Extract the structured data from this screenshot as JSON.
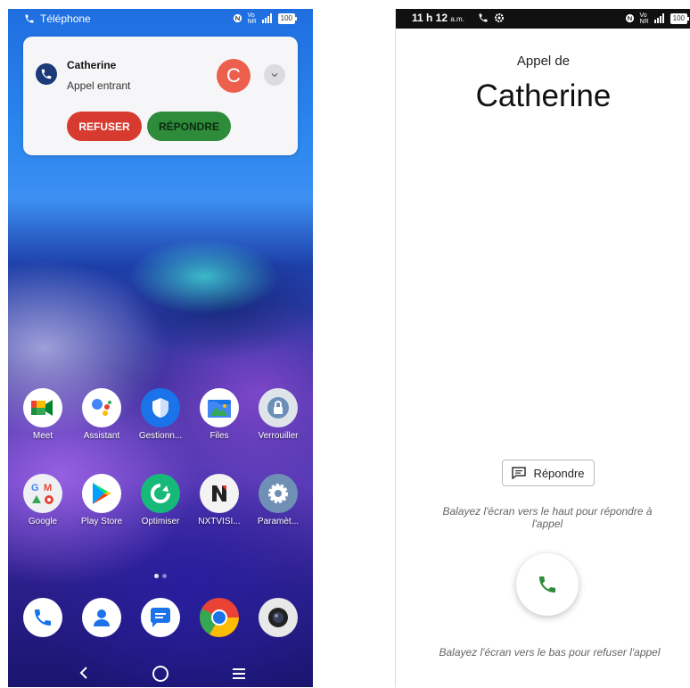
{
  "left_phone": {
    "status_bar": {
      "app_name": "Téléphone",
      "battery": "100"
    },
    "notification": {
      "caller": "Catherine",
      "subtitle": "Appel entrant",
      "avatar_letter": "C",
      "refuse_label": "REFUSER",
      "answer_label": "RÉPONDRE"
    },
    "apps_row1": [
      {
        "label": "Meet"
      },
      {
        "label": "Assistant"
      },
      {
        "label": "Gestionn..."
      },
      {
        "label": "Files"
      },
      {
        "label": "Verrouiller"
      }
    ],
    "apps_row2": [
      {
        "label": "Google"
      },
      {
        "label": "Play Store"
      },
      {
        "label": "Optimiser"
      },
      {
        "label": "NXTVISI..."
      },
      {
        "label": "Paramèt..."
      }
    ]
  },
  "right_phone": {
    "status_bar": {
      "time": "11 h 12",
      "ampm": "a.m.",
      "battery": "100"
    },
    "call_from": "Appel de",
    "caller": "Catherine",
    "reply_label": "Répondre",
    "hint_up": "Balayez l'écran vers le haut pour répondre à l'appel",
    "hint_down": "Balayez l'écran vers le bas pour refuser l'appel"
  },
  "colors": {
    "refuse": "#d73a2e",
    "answer": "#2e8b3a",
    "avatar": "#ec5f4d",
    "call_icon_bg": "#1b3a7a"
  }
}
